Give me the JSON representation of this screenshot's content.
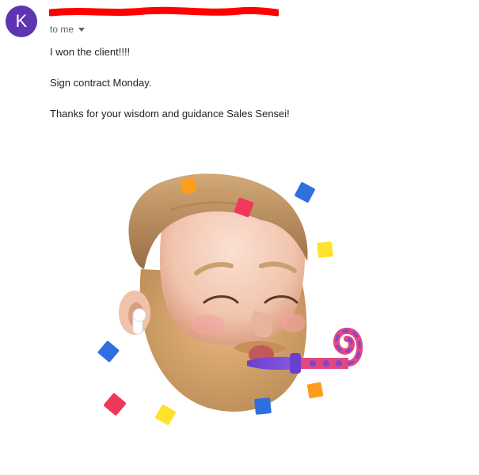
{
  "sender": {
    "avatar_letter": "K",
    "avatar_color": "#5e35b1",
    "name_redacted": true,
    "redaction_color": "#ff0000"
  },
  "recipient": {
    "label": "to me",
    "caret_icon": "chevron-down-icon"
  },
  "message": {
    "lines": [
      "I won the client!!!!",
      "Sign contract Monday.",
      "Thanks for your wisdom and guidance Sales Sensei!"
    ]
  },
  "attachment": {
    "kind": "memoji-sticker",
    "icon": "party-memoji-icon",
    "colors": {
      "skin": "#f3c9b4",
      "hair": "#b88a5a",
      "beard": "#d3a067",
      "confetti_orange": "#ff9d1b",
      "confetti_blue": "#2f6fe0",
      "confetti_pink": "#f0385a",
      "confetti_yellow": "#ffe22b",
      "blower_purple": "#7b45d8",
      "blower_pink": "#e0487f"
    }
  }
}
